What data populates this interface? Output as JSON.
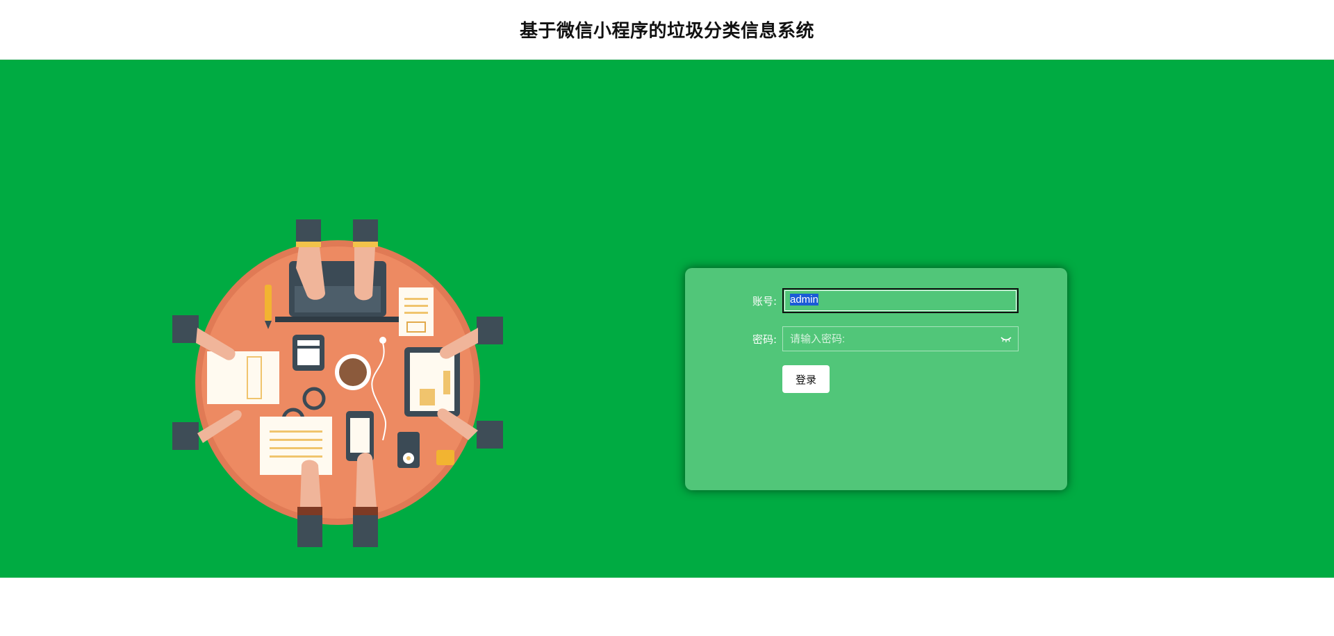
{
  "header": {
    "title": "基于微信小程序的垃圾分类信息系统"
  },
  "colors": {
    "banner": "#00ab42",
    "card": "#51c679",
    "table": "#e8835b"
  },
  "login": {
    "account_label": "账号:",
    "account_value": "admin",
    "password_label": "密码:",
    "password_placeholder": "请输入密码:",
    "submit_label": "登录"
  },
  "icons": {
    "password_toggle": "eye-closed-icon",
    "illustration": "team-meeting-table-illustration"
  }
}
